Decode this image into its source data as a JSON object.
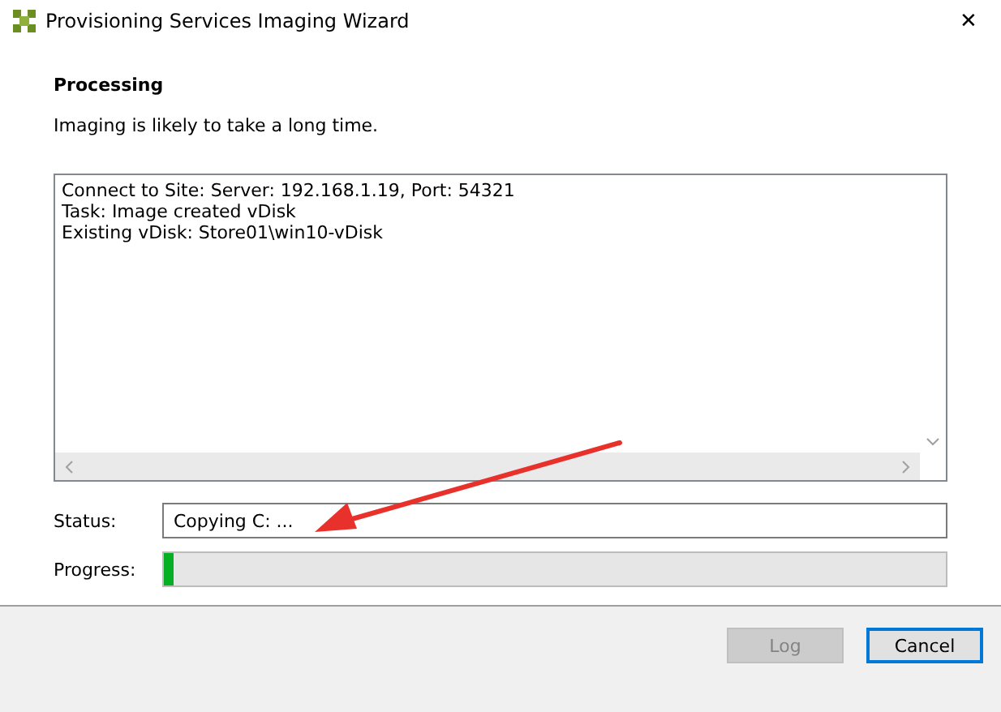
{
  "window": {
    "title": "Provisioning Services Imaging Wizard",
    "close": "✕"
  },
  "heading": "Processing",
  "subtitle": "Imaging is likely to take a long time.",
  "log_lines": [
    "Connect to Site: Server: 192.168.1.19, Port: 54321",
    "Task: Image created vDisk",
    "Existing vDisk: Store01\\win10-vDisk"
  ],
  "status": {
    "label": "Status:",
    "value": "Copying C: ..."
  },
  "progress": {
    "label": "Progress:",
    "level": 0.012
  },
  "buttons": [
    {
      "label": "Log",
      "disabled": true,
      "focused": false
    },
    {
      "label": "Cancel",
      "disabled": false,
      "focused": true
    }
  ]
}
